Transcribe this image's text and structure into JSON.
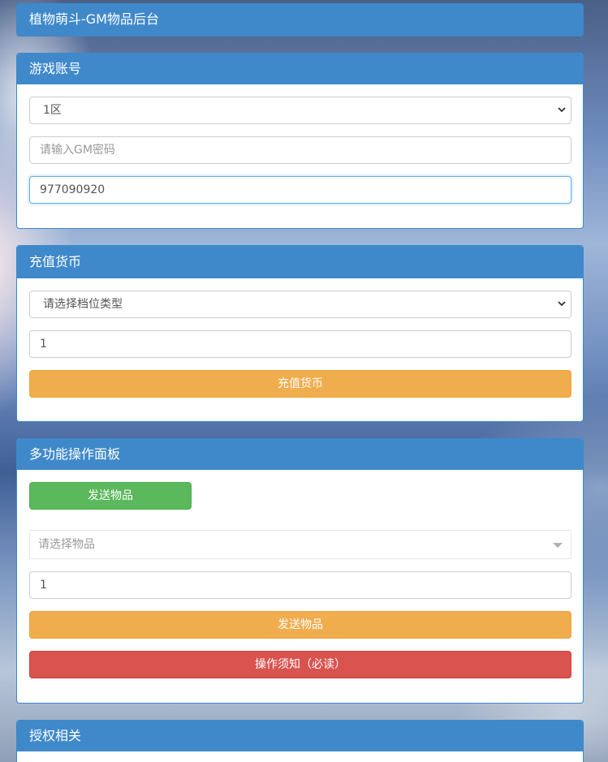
{
  "header": {
    "title": "植物萌斗-GM物品后台"
  },
  "account": {
    "title": "游戏账号",
    "server_selected": "1区",
    "gm_password_placeholder": "请输入GM密码",
    "account_value": "977090920"
  },
  "recharge": {
    "title": "充值货币",
    "tier_selected": "请选择档位类型",
    "amount_value": "1",
    "submit_label": "充值货币"
  },
  "multi": {
    "title": "多功能操作面板",
    "send_tab_label": "发送物品",
    "item_placeholder": "请选择物品",
    "quantity_value": "1",
    "send_label": "发送物品",
    "notice_label": "操作须知（必读）"
  },
  "license": {
    "title": "授权相关"
  },
  "colors": {
    "panel_header": "#3f89ca",
    "warning": "#f0ad4e",
    "danger": "#d9534f",
    "success": "#5cb85c"
  }
}
